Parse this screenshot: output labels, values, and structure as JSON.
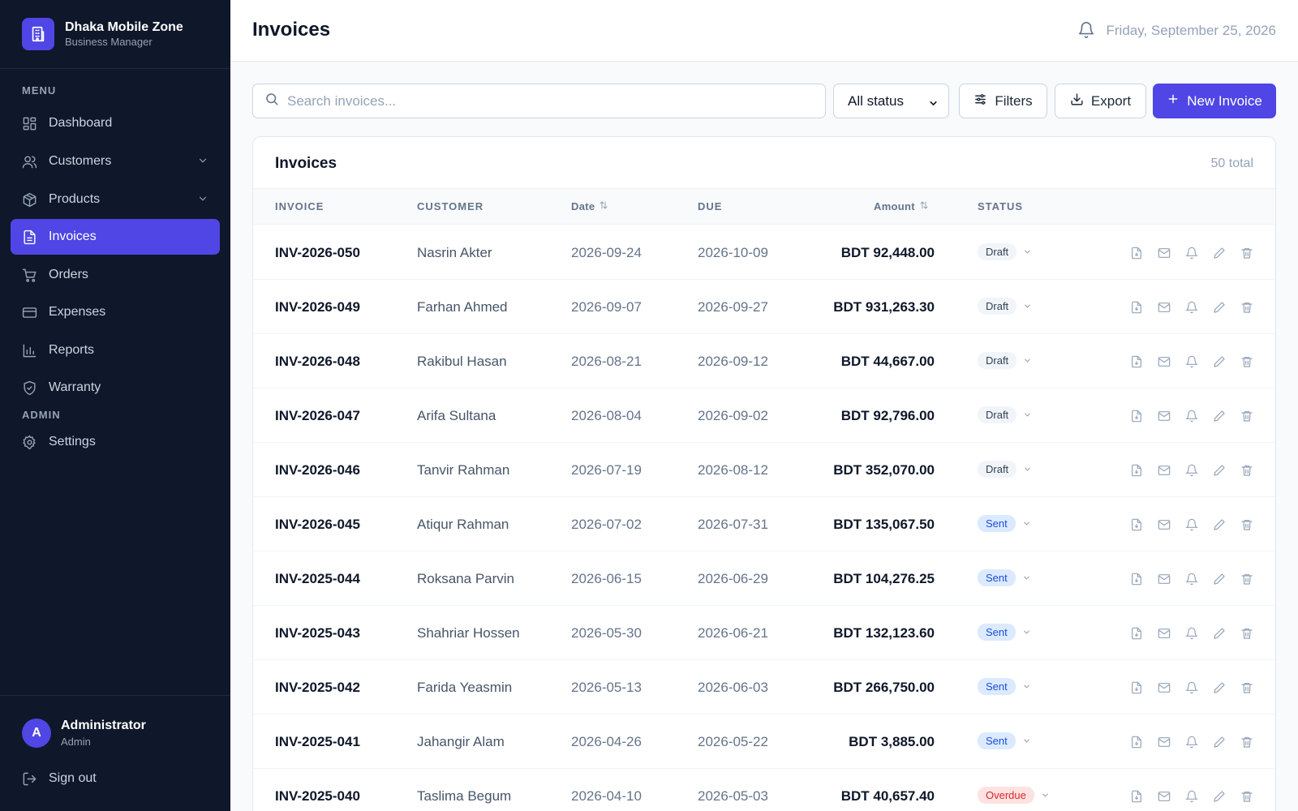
{
  "brand": {
    "name": "Dhaka Mobile Zone",
    "subtitle": "Business Manager"
  },
  "sidebar": {
    "menu_label": "MENU",
    "admin_label": "ADMIN",
    "items": [
      {
        "label": "Dashboard",
        "icon": "dashboard-icon"
      },
      {
        "label": "Customers",
        "icon": "users-icon"
      },
      {
        "label": "Products",
        "icon": "box-icon"
      },
      {
        "label": "Invoices",
        "icon": "file-icon"
      },
      {
        "label": "Orders",
        "icon": "cart-icon"
      },
      {
        "label": "Expenses",
        "icon": "card-icon"
      },
      {
        "label": "Reports",
        "icon": "chart-icon"
      },
      {
        "label": "Warranty",
        "icon": "shield-icon"
      }
    ],
    "settings_label": "Settings",
    "active": "Invoices"
  },
  "user": {
    "initial": "A",
    "name": "Administrator",
    "role": "Admin",
    "signout_label": "Sign out"
  },
  "header": {
    "title": "Invoices",
    "date": "Friday, September 25, 2026"
  },
  "toolbar": {
    "search_placeholder": "Search invoices...",
    "status_value": "All status",
    "filters_label": "Filters",
    "export_label": "Export",
    "new_label": "New Invoice"
  },
  "table": {
    "title": "Invoices",
    "total": "50 total",
    "headers": {
      "invoice": "INVOICE",
      "customer": "CUSTOMER",
      "date": "Date",
      "due": "DUE",
      "amount": "Amount",
      "status": "STATUS"
    },
    "rows": [
      {
        "invoice": "INV-2026-050",
        "customer": "Nasrin Akter",
        "date": "2026-09-24",
        "due": "2026-10-09",
        "amount": "BDT 92,448.00",
        "status": "Draft"
      },
      {
        "invoice": "INV-2026-049",
        "customer": "Farhan Ahmed",
        "date": "2026-09-07",
        "due": "2026-09-27",
        "amount": "BDT 931,263.30",
        "status": "Draft"
      },
      {
        "invoice": "INV-2026-048",
        "customer": "Rakibul Hasan",
        "date": "2026-08-21",
        "due": "2026-09-12",
        "amount": "BDT 44,667.00",
        "status": "Draft"
      },
      {
        "invoice": "INV-2026-047",
        "customer": "Arifa Sultana",
        "date": "2026-08-04",
        "due": "2026-09-02",
        "amount": "BDT 92,796.00",
        "status": "Draft"
      },
      {
        "invoice": "INV-2026-046",
        "customer": "Tanvir Rahman",
        "date": "2026-07-19",
        "due": "2026-08-12",
        "amount": "BDT 352,070.00",
        "status": "Draft"
      },
      {
        "invoice": "INV-2026-045",
        "customer": "Atiqur Rahman",
        "date": "2026-07-02",
        "due": "2026-07-31",
        "amount": "BDT 135,067.50",
        "status": "Sent"
      },
      {
        "invoice": "INV-2025-044",
        "customer": "Roksana Parvin",
        "date": "2026-06-15",
        "due": "2026-06-29",
        "amount": "BDT 104,276.25",
        "status": "Sent"
      },
      {
        "invoice": "INV-2025-043",
        "customer": "Shahriar Hossen",
        "date": "2026-05-30",
        "due": "2026-06-21",
        "amount": "BDT 132,123.60",
        "status": "Sent"
      },
      {
        "invoice": "INV-2025-042",
        "customer": "Farida Yeasmin",
        "date": "2026-05-13",
        "due": "2026-06-03",
        "amount": "BDT 266,750.00",
        "status": "Sent"
      },
      {
        "invoice": "INV-2025-041",
        "customer": "Jahangir Alam",
        "date": "2026-04-26",
        "due": "2026-05-22",
        "amount": "BDT 3,885.00",
        "status": "Sent"
      },
      {
        "invoice": "INV-2025-040",
        "customer": "Taslima Begum",
        "date": "2026-04-10",
        "due": "2026-05-03",
        "amount": "BDT 40,657.40",
        "status": "Overdue"
      }
    ],
    "row_actions": [
      "pdf-icon",
      "mail-icon",
      "bell-icon",
      "edit-icon",
      "trash-icon"
    ]
  },
  "colors": {
    "sidebar_bg": "#0f172a",
    "accent": "#4f46e5",
    "draft": "#f1f5f9",
    "sent": "#dbeafe",
    "overdue": "#fee2e2"
  }
}
